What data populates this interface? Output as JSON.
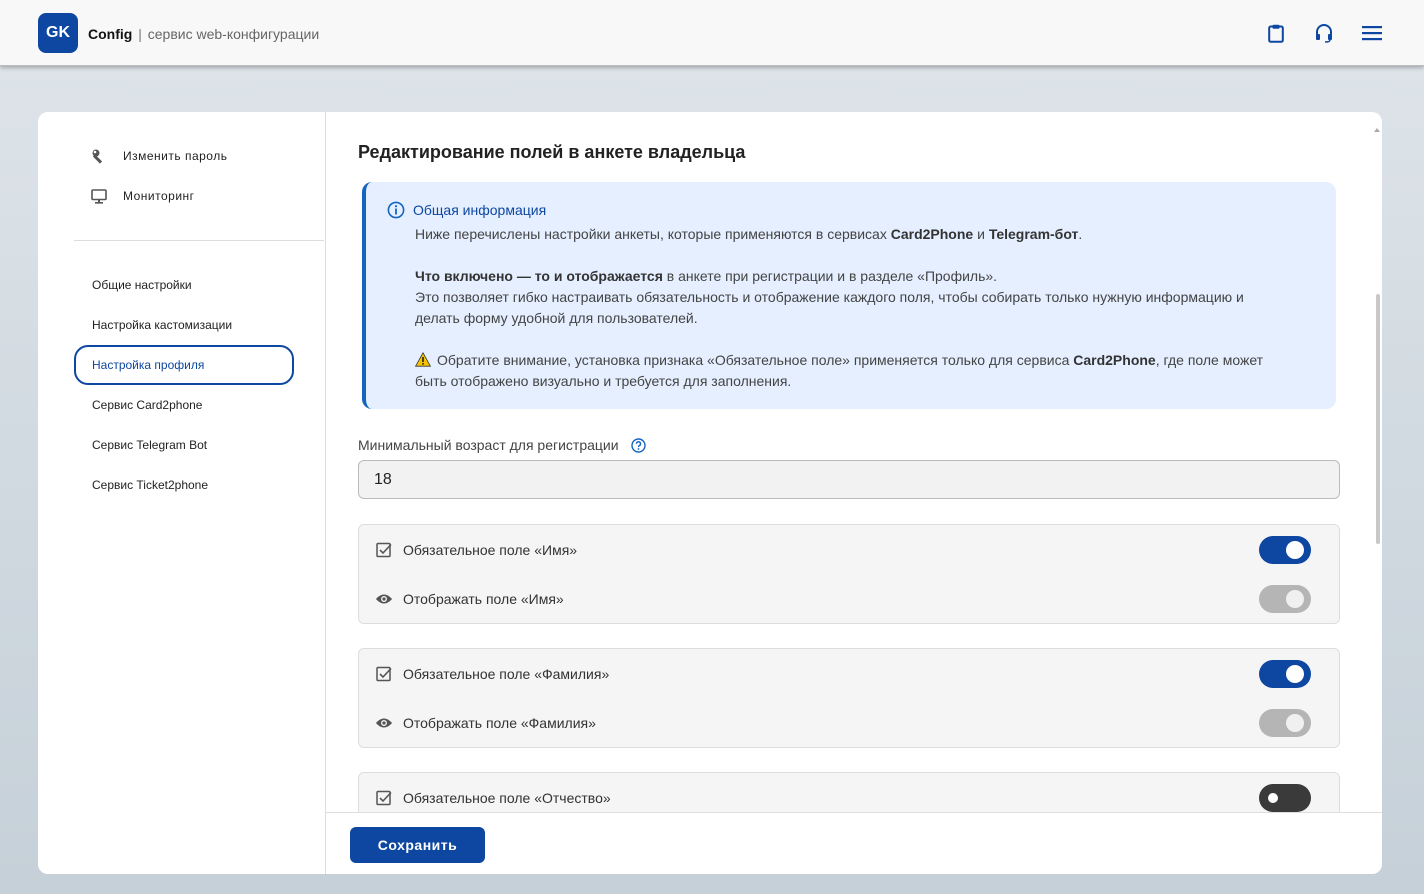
{
  "header": {
    "logo_text": "GK",
    "app_name": "Config",
    "separator": "|",
    "app_subtitle": "сервис web-конфигурации",
    "icons": [
      "clipboard-icon",
      "headset-icon",
      "menu-icon"
    ]
  },
  "sidebar": {
    "top_items": [
      {
        "label": "Изменить пароль",
        "icon": "wrench-icon"
      },
      {
        "label": "Мониторинг",
        "icon": "monitor-icon"
      }
    ],
    "items": [
      {
        "label": "Общие настройки"
      },
      {
        "label": "Настройка кастомизации"
      },
      {
        "label": "Настройка профиля",
        "active": true
      },
      {
        "label": "Сервис Card2phone"
      },
      {
        "label": "Сервис Telegram Bot"
      },
      {
        "label": "Сервис Ticket2phone"
      }
    ]
  },
  "main": {
    "title": "Редактирование полей в анкете владельца",
    "info": {
      "title": "Общая информация",
      "line1_prefix": "Ниже перечислены настройки анкеты, которые применяются в сервисах ",
      "line1_b1": "Card2Phone",
      "line1_mid": " и ",
      "line1_b2": "Telegram-бот",
      "line1_end": ".",
      "line2_bold": "Что включено — то и отображается",
      "line2_rest": " в анкете при регистрации и в разделе «Профиль».",
      "line3": "Это позволяет гибко настраивать обязательность и отображение каждого поля, чтобы собирать только нужную информацию и",
      "line4": "делать форму удобной для пользователей.",
      "warn_prefix": "Обратите внимание, установка признака «Обязательное поле» применяется только для сервиса ",
      "warn_bold": "Card2Phone",
      "warn_rest": ", где поле может",
      "warn_line2": "быть отображено визуально и требуется для заполнения."
    },
    "age": {
      "label": "Минимальный возраст для регистрации",
      "value": "18"
    },
    "cards": [
      {
        "required_label": "Обязательное поле «Имя»",
        "required_on": true,
        "display_label": "Отображать поле «Имя»",
        "display_state": "disabled-on"
      },
      {
        "required_label": "Обязательное поле «Фамилия»",
        "required_on": true,
        "display_label": "Отображать поле «Фамилия»",
        "display_state": "disabled-on"
      },
      {
        "required_label": "Обязательное поле «Отчество»",
        "required_on": false
      }
    ]
  },
  "footer": {
    "save_label": "Сохранить"
  },
  "colors": {
    "primary": "#0d47a1",
    "info_bg": "#e5efff",
    "toggle_disabled": "#b5b5b5",
    "toggle_off": "#3a3a3a"
  }
}
